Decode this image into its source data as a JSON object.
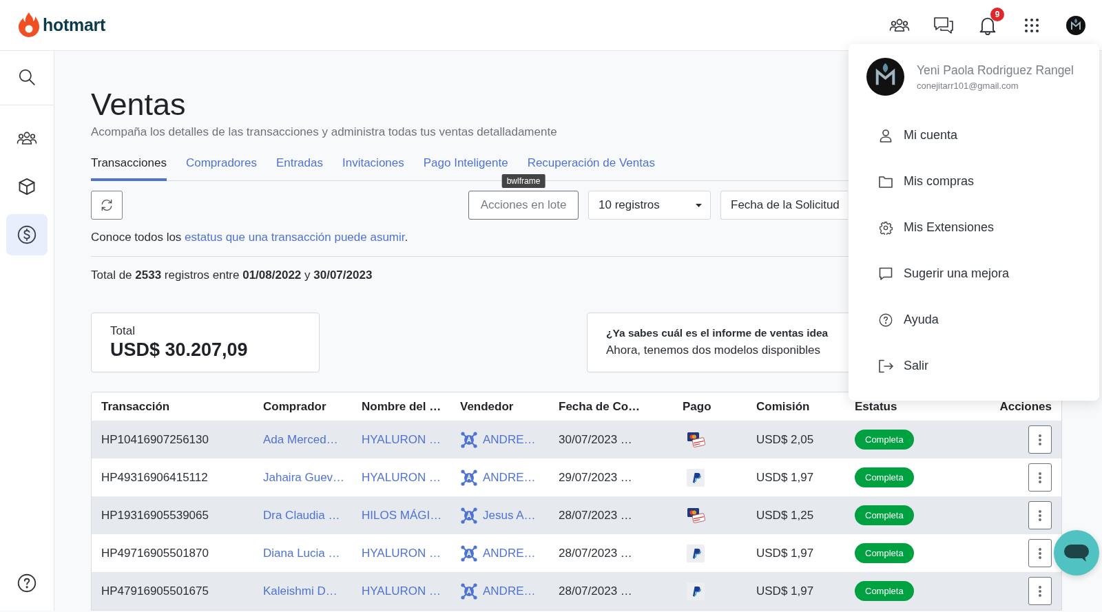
{
  "logo": {
    "text": "hotmart"
  },
  "header": {
    "icons": [
      {
        "kind": "people"
      },
      {
        "kind": "chat"
      },
      {
        "kind": "bell",
        "badge": "9"
      },
      {
        "kind": "apps"
      },
      {
        "kind": "avatar"
      }
    ]
  },
  "sidebar": {
    "items": [
      {
        "kind": "search",
        "selected": false
      },
      {
        "kind": "people",
        "selected": false
      },
      {
        "kind": "box",
        "selected": false
      },
      {
        "kind": "dollar",
        "selected": true
      },
      {
        "kind": "help",
        "selected": false
      }
    ]
  },
  "page": {
    "title": "Ventas",
    "subtitle": "Acompaña los detalles de las transacciones y administra todas tus ventas detalladamente"
  },
  "tabs": [
    {
      "label": "Transacciones",
      "selected": true
    },
    {
      "label": "Compradores",
      "selected": false
    },
    {
      "label": "Entradas",
      "selected": false
    },
    {
      "label": "Invitaciones",
      "selected": false
    },
    {
      "label": "Pago Inteligente",
      "selected": false
    },
    {
      "label": "Recuperación de Ventas",
      "selected": false
    }
  ],
  "toolbar": {
    "tooltip": "bwlframe",
    "bulk_actions": "Acciones en lote",
    "page_size": "10 registros",
    "date_filter": "Fecha de la Solicitud"
  },
  "status_note": {
    "text": "Conoce todos los ",
    "link": "estatus que una transacción puede asumir",
    "end": "."
  },
  "summary": "Total de **2533** registros entre **01/08/2022** y **30/07/2023**",
  "total_card": {
    "label": "Total",
    "value": "USD$ 30.207,09"
  },
  "info_card": {
    "title": "¿Ya sabes cuál es el informe de ventas idea",
    "text": "Ahora, tenemos dos modelos disponibles"
  },
  "table": {
    "columns": [
      "Transacción",
      "Comprador",
      "Nombre del …",
      "Vendedor",
      "Fecha de Co…",
      "Pago",
      "Comisión",
      "Estatus",
      "Acciones"
    ],
    "rows": [
      {
        "transaction": "HP10416907256130",
        "buyer": "Ada Merced…",
        "product": "HYALURON …",
        "seller": "ANDRE…",
        "date": "30/07/2023 …",
        "payment": {
          "kind": "card"
        },
        "commission": "USD$ 2,05",
        "status": "Completa"
      },
      {
        "transaction": "HP49316906415112",
        "buyer": "Jahaira Guev…",
        "product": "HYALURON …",
        "seller": "ANDRE…",
        "date": "29/07/2023 …",
        "payment": {
          "kind": "paypal"
        },
        "commission": "USD$ 1,97",
        "status": "Completa"
      },
      {
        "transaction": "HP19316905539065",
        "buyer": "Dra Claudia …",
        "product": "HILOS MÁGI…",
        "seller": "Jesus A…",
        "date": "28/07/2023 …",
        "payment": {
          "kind": "card"
        },
        "commission": "USD$ 1,25",
        "status": "Completa"
      },
      {
        "transaction": "HP49716905501870",
        "buyer": "Diana Lucia …",
        "product": "HYALURON …",
        "seller": "ANDRE…",
        "date": "28/07/2023 …",
        "payment": {
          "kind": "paypal"
        },
        "commission": "USD$ 1,97",
        "status": "Completa"
      },
      {
        "transaction": "HP47916905501675",
        "buyer": "Kaleishmi D…",
        "product": "HYALURON …",
        "seller": "ANDRE…",
        "date": "28/07/2023 …",
        "payment": {
          "kind": "paypal"
        },
        "commission": "USD$ 1,97",
        "status": "Completa"
      }
    ]
  },
  "user_menu": {
    "name": "Yeni Paola Rodriguez Rangel",
    "email": "conejitarr101@gmail.com",
    "items": [
      {
        "kind": "person",
        "label": "Mi cuenta"
      },
      {
        "kind": "folder",
        "label": "Mis compras"
      },
      {
        "kind": "gear",
        "label": "Mis Extensiones"
      },
      {
        "kind": "comment",
        "label": "Sugerir una mejora"
      },
      {
        "kind": "help",
        "label": "Ayuda"
      },
      {
        "kind": "logout",
        "label": "Salir"
      }
    ]
  }
}
